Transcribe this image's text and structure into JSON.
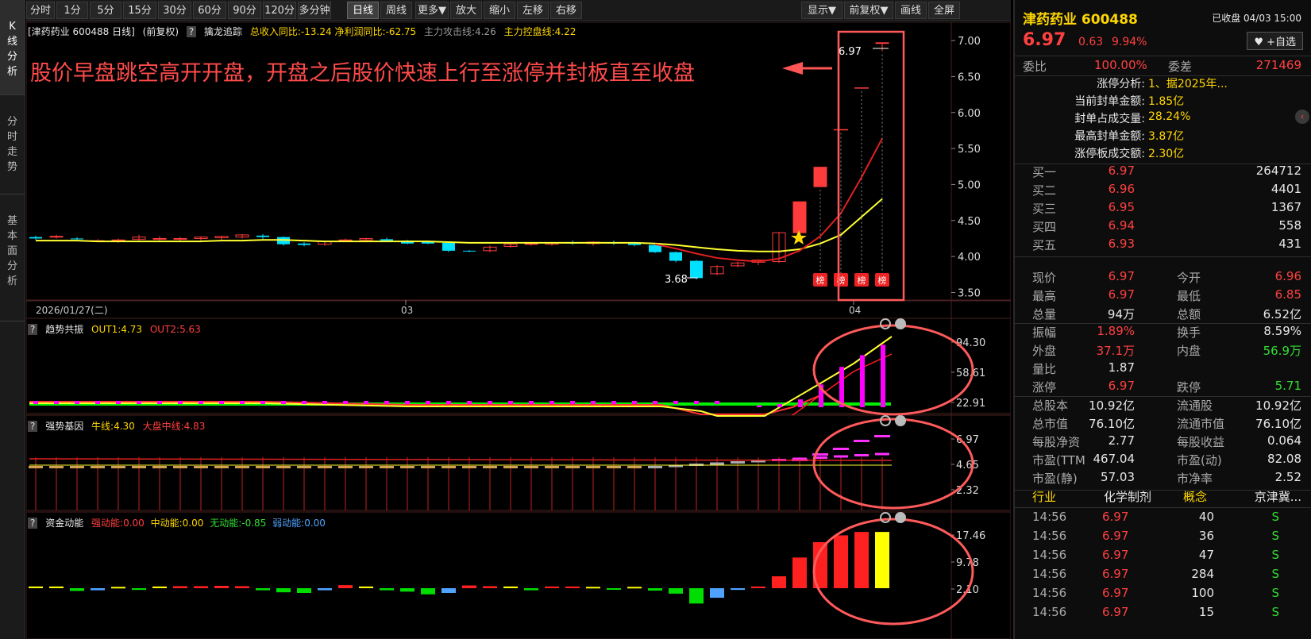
{
  "left_nav": {
    "tabs": [
      "K线分析",
      "分时走势",
      "基本面分析"
    ]
  },
  "toolbar": {
    "left": [
      "分时",
      "1分",
      "5分",
      "15分",
      "30分",
      "60分",
      "90分",
      "120分",
      "多分钟",
      "日线",
      "周线",
      "更多▼",
      "放大",
      "缩小",
      "左移",
      "右移"
    ],
    "right": [
      "显示▼",
      "前复权▼",
      "画线",
      "全屏"
    ],
    "active": "日线"
  },
  "main_header": {
    "stock": "[津药药业 600488 日线]",
    "adjust": "(前复权)",
    "help": "?",
    "indicator": "擒龙追踪",
    "inc1": "总收入同比:-13.24",
    "inc2": "净利润同比:-62.75",
    "atk": "主力攻击线:4.26",
    "ctrl": "主力控盘线:4.22"
  },
  "annotation": "股价早盘跳空高开开盘，开盘之后股价快速上行至涨停并封板直至收盘",
  "price_axis": [
    "7.00",
    "6.50",
    "6.00",
    "5.50",
    "5.00",
    "4.50",
    "4.00",
    "3.50"
  ],
  "price_range": [
    3.45,
    7.1
  ],
  "high_label": "6.97",
  "low_label": "3.68",
  "badge": "榜",
  "date_axis": {
    "first": "2026/01/27(二)",
    "mar": "03",
    "apr": "04"
  },
  "candles": [
    {
      "o": 4.27,
      "h": 4.29,
      "l": 4.23,
      "c": 4.25
    },
    {
      "o": 4.27,
      "h": 4.3,
      "l": 4.25,
      "c": 4.28
    },
    {
      "o": 4.25,
      "h": 4.27,
      "l": 4.22,
      "c": 4.24
    },
    {
      "o": 4.22,
      "h": 4.24,
      "l": 4.2,
      "c": 4.22
    },
    {
      "o": 4.22,
      "h": 4.25,
      "l": 4.19,
      "c": 4.23
    },
    {
      "o": 4.24,
      "h": 4.3,
      "l": 4.22,
      "c": 4.27
    },
    {
      "o": 4.25,
      "h": 4.28,
      "l": 4.22,
      "c": 4.25
    },
    {
      "o": 4.24,
      "h": 4.27,
      "l": 4.21,
      "c": 4.25
    },
    {
      "o": 4.25,
      "h": 4.28,
      "l": 4.22,
      "c": 4.27
    },
    {
      "o": 4.26,
      "h": 4.29,
      "l": 4.23,
      "c": 4.28
    },
    {
      "o": 4.27,
      "h": 4.31,
      "l": 4.25,
      "c": 4.3
    },
    {
      "o": 4.29,
      "h": 4.31,
      "l": 4.24,
      "c": 4.27
    },
    {
      "o": 4.27,
      "h": 4.28,
      "l": 4.15,
      "c": 4.17
    },
    {
      "o": 4.18,
      "h": 4.2,
      "l": 4.14,
      "c": 4.16
    },
    {
      "o": 4.17,
      "h": 4.22,
      "l": 4.15,
      "c": 4.21
    },
    {
      "o": 4.22,
      "h": 4.25,
      "l": 4.2,
      "c": 4.23
    },
    {
      "o": 4.23,
      "h": 4.26,
      "l": 4.21,
      "c": 4.25
    },
    {
      "o": 4.24,
      "h": 4.26,
      "l": 4.2,
      "c": 4.22
    },
    {
      "o": 4.22,
      "h": 4.23,
      "l": 4.17,
      "c": 4.18
    },
    {
      "o": 4.2,
      "h": 4.22,
      "l": 4.17,
      "c": 4.18
    },
    {
      "o": 4.19,
      "h": 4.21,
      "l": 4.06,
      "c": 4.08
    },
    {
      "o": 4.08,
      "h": 4.09,
      "l": 4.06,
      "c": 4.07
    },
    {
      "o": 4.08,
      "h": 4.15,
      "l": 4.06,
      "c": 4.13
    },
    {
      "o": 4.14,
      "h": 4.19,
      "l": 4.12,
      "c": 4.17
    },
    {
      "o": 4.17,
      "h": 4.2,
      "l": 4.15,
      "c": 4.18
    },
    {
      "o": 4.17,
      "h": 4.2,
      "l": 4.15,
      "c": 4.19
    },
    {
      "o": 4.2,
      "h": 4.22,
      "l": 4.16,
      "c": 4.18
    },
    {
      "o": 4.18,
      "h": 4.21,
      "l": 4.15,
      "c": 4.2
    },
    {
      "o": 4.2,
      "h": 4.22,
      "l": 4.16,
      "c": 4.18
    },
    {
      "o": 4.18,
      "h": 4.2,
      "l": 4.14,
      "c": 4.16
    },
    {
      "o": 4.16,
      "h": 4.18,
      "l": 4.05,
      "c": 4.06
    },
    {
      "o": 4.06,
      "h": 4.07,
      "l": 3.92,
      "c": 3.94
    },
    {
      "o": 3.94,
      "h": 3.95,
      "l": 3.68,
      "c": 3.7
    },
    {
      "o": 3.76,
      "h": 3.88,
      "l": 3.74,
      "c": 3.86
    },
    {
      "o": 3.87,
      "h": 3.93,
      "l": 3.85,
      "c": 3.91
    },
    {
      "o": 3.92,
      "h": 3.96,
      "l": 3.88,
      "c": 3.95
    },
    {
      "o": 3.93,
      "h": 4.34,
      "l": 3.91,
      "c": 4.33
    },
    {
      "o": 4.33,
      "h": 4.76,
      "l": 4.33,
      "c": 4.76
    },
    {
      "o": 4.97,
      "h": 5.24,
      "l": 4.97,
      "c": 5.24
    },
    {
      "o": 5.76,
      "h": 5.76,
      "l": 5.76,
      "c": 5.76
    },
    {
      "o": 6.34,
      "h": 6.34,
      "l": 6.34,
      "c": 6.34
    },
    {
      "o": 6.96,
      "h": 6.97,
      "l": 6.85,
      "c": 6.97
    }
  ],
  "ma_yellow": [
    4.22,
    4.22,
    4.22,
    4.21,
    4.21,
    4.21,
    4.21,
    4.21,
    4.21,
    4.22,
    4.22,
    4.23,
    4.23,
    4.22,
    4.21,
    4.21,
    4.21,
    4.21,
    4.21,
    4.21,
    4.2,
    4.19,
    4.19,
    4.19,
    4.19,
    4.19,
    4.19,
    4.19,
    4.19,
    4.19,
    4.18,
    4.16,
    4.13,
    4.1,
    4.08,
    4.07,
    4.07,
    4.1,
    4.18,
    4.3,
    4.55,
    4.8
  ],
  "ma_red": [
    null,
    null,
    null,
    null,
    null,
    null,
    null,
    null,
    null,
    null,
    null,
    null,
    null,
    null,
    null,
    null,
    null,
    null,
    null,
    null,
    null,
    null,
    null,
    null,
    null,
    null,
    null,
    null,
    null,
    null,
    4.17,
    4.11,
    4.04,
    3.98,
    3.95,
    3.93,
    3.97,
    4.08,
    4.28,
    4.6,
    5.1,
    5.64
  ],
  "panel2": {
    "help": "?",
    "name": "趋势共振",
    "out1": "OUT1:4.73",
    "out2": "OUT2:5.63",
    "axis": [
      "94.30",
      "58.61",
      "22.91"
    ],
    "bars": [
      3,
      5,
      12,
      35,
      62,
      80,
      96
    ]
  },
  "panel3": {
    "help": "?",
    "name": "强势基因",
    "bull": "牛线:4.30",
    "mid": "大盘中线:4.83",
    "axis": [
      "6.97",
      "4.65",
      "2.32"
    ]
  },
  "panel4": {
    "help": "?",
    "name": "资金动能",
    "strong": "强动能:0.00",
    "medium": "中动能:0.00",
    "none": "无动能:-0.85",
    "weak": "弱动能:0.00",
    "axis": [
      "17.46",
      "9.78",
      "2.10"
    ],
    "bars": [
      {
        "v": 0.5,
        "c": "#ffff00"
      },
      {
        "v": 0.5,
        "c": "#ffff00"
      },
      {
        "v": -0.8,
        "c": "#00dd00"
      },
      {
        "v": -0.6,
        "c": "#4fa3ff"
      },
      {
        "v": 0.4,
        "c": "#ffff00"
      },
      {
        "v": -0.5,
        "c": "#00dd00"
      },
      {
        "v": 0.5,
        "c": "#ffff00"
      },
      {
        "v": 0.6,
        "c": "#ff2020"
      },
      {
        "v": 0.6,
        "c": "#ff2020"
      },
      {
        "v": 0.7,
        "c": "#ff2020"
      },
      {
        "v": 0.6,
        "c": "#ff2020"
      },
      {
        "v": -0.6,
        "c": "#00dd00"
      },
      {
        "v": -1.2,
        "c": "#00dd00"
      },
      {
        "v": -1.4,
        "c": "#00dd00"
      },
      {
        "v": -0.6,
        "c": "#4fa3ff"
      },
      {
        "v": 0.9,
        "c": "#ff2020"
      },
      {
        "v": 0.5,
        "c": "#ffff00"
      },
      {
        "v": -0.6,
        "c": "#00dd00"
      },
      {
        "v": -1.0,
        "c": "#00dd00"
      },
      {
        "v": -1.8,
        "c": "#00dd00"
      },
      {
        "v": -1.4,
        "c": "#4fa3ff"
      },
      {
        "v": 0.8,
        "c": "#ff2020"
      },
      {
        "v": 0.6,
        "c": "#ff2020"
      },
      {
        "v": 0.5,
        "c": "#ffff00"
      },
      {
        "v": -0.6,
        "c": "#00dd00"
      },
      {
        "v": 0.5,
        "c": "#ff2020"
      },
      {
        "v": 0.5,
        "c": "#ff2020"
      },
      {
        "v": 0.4,
        "c": "#ffff00"
      },
      {
        "v": -0.4,
        "c": "#00dd00"
      },
      {
        "v": 0.4,
        "c": "#ffff00"
      },
      {
        "v": -0.7,
        "c": "#00dd00"
      },
      {
        "v": -1.6,
        "c": "#00dd00"
      },
      {
        "v": -4.5,
        "c": "#00dd00"
      },
      {
        "v": -2.8,
        "c": "#4fa3ff"
      },
      {
        "v": -0.5,
        "c": "#4fa3ff"
      },
      {
        "v": 0.5,
        "c": "#ff2020"
      },
      {
        "v": 3.5,
        "c": "#ff2020"
      },
      {
        "v": 9.0,
        "c": "#ff2020"
      },
      {
        "v": 13.5,
        "c": "#ff2020"
      },
      {
        "v": 15.5,
        "c": "#ff2020"
      },
      {
        "v": 16.5,
        "c": "#ff2020"
      },
      {
        "v": 16.5,
        "c": "#ffff00"
      }
    ]
  },
  "right_panel": {
    "title": "津药药业 600488",
    "status": "已收盘 04/03 15:00",
    "price": "6.97",
    "chg": "0.63",
    "pct": "9.94%",
    "watch": "♥ +自选",
    "wb_label": "委比",
    "wb": "100.00%",
    "wc_label": "委差",
    "wc": "271469",
    "limit": [
      {
        "l": "涨停分析:",
        "v": "1、据2025年..."
      },
      {
        "l": "当前封单金额:",
        "v": "1.85亿"
      },
      {
        "l": "封单占成交量:",
        "v": "28.24%"
      },
      {
        "l": "最高封单金额:",
        "v": "3.87亿"
      },
      {
        "l": "涨停板成交额:",
        "v": "2.30亿"
      }
    ],
    "bids": [
      {
        "l": "买一",
        "p": "6.97",
        "v": "264712"
      },
      {
        "l": "买二",
        "p": "6.96",
        "v": "4401"
      },
      {
        "l": "买三",
        "p": "6.95",
        "v": "1367"
      },
      {
        "l": "买四",
        "p": "6.94",
        "v": "558"
      },
      {
        "l": "买五",
        "p": "6.93",
        "v": "431"
      }
    ],
    "stats": [
      [
        {
          "l": "现价",
          "v": "6.97",
          "c": "red"
        },
        {
          "l": "今开",
          "v": "6.96",
          "c": "red"
        }
      ],
      [
        {
          "l": "最高",
          "v": "6.97",
          "c": "red"
        },
        {
          "l": "最低",
          "v": "6.85",
          "c": "red"
        }
      ],
      [
        {
          "l": "总量",
          "v": "94万",
          "c": "white"
        },
        {
          "l": "总额",
          "v": "6.52亿",
          "c": "white"
        }
      ],
      [
        {
          "l": "振幅",
          "v": "1.89%",
          "c": "red"
        },
        {
          "l": "换手",
          "v": "8.59%",
          "c": "white"
        }
      ],
      [
        {
          "l": "外盘",
          "v": "37.1万",
          "c": "red"
        },
        {
          "l": "内盘",
          "v": "56.9万",
          "c": "green"
        }
      ],
      [
        {
          "l": "量比",
          "v": "1.87",
          "c": "white"
        }
      ],
      [
        {
          "l": "涨停",
          "v": "6.97",
          "c": "red"
        },
        {
          "l": "跌停",
          "v": "5.71",
          "c": "green"
        }
      ],
      [
        {
          "l": "总股本",
          "v": "10.92亿",
          "c": "white"
        },
        {
          "l": "流通股",
          "v": "10.92亿",
          "c": "white"
        }
      ],
      [
        {
          "l": "总市值",
          "v": "76.10亿",
          "c": "white"
        },
        {
          "l": "流通市值",
          "v": "76.10亿",
          "c": "white"
        }
      ],
      [
        {
          "l": "每股净资",
          "v": "2.77",
          "c": "white"
        },
        {
          "l": "每股收益",
          "v": "0.064",
          "c": "white"
        }
      ],
      [
        {
          "l": "市盈(TTM",
          "v": "467.04",
          "c": "white"
        },
        {
          "l": "市盈(动)",
          "v": "82.08",
          "c": "white"
        }
      ],
      [
        {
          "l": "市盈(静)",
          "v": "57.03",
          "c": "white"
        },
        {
          "l": "市净率",
          "v": "2.52",
          "c": "white"
        }
      ]
    ],
    "industry": {
      "l": "行业",
      "v": "化学制剂",
      "cl": "概念",
      "cv": "京津冀..."
    },
    "trades": [
      {
        "t": "14:56",
        "p": "6.97",
        "v": "40",
        "s": "S"
      },
      {
        "t": "14:56",
        "p": "6.97",
        "v": "36",
        "s": "S"
      },
      {
        "t": "14:56",
        "p": "6.97",
        "v": "47",
        "s": "S"
      },
      {
        "t": "14:56",
        "p": "6.97",
        "v": "284",
        "s": "S"
      },
      {
        "t": "14:56",
        "p": "6.97",
        "v": "100",
        "s": "S"
      },
      {
        "t": "14:56",
        "p": "6.97",
        "v": "15",
        "s": "S"
      }
    ]
  }
}
